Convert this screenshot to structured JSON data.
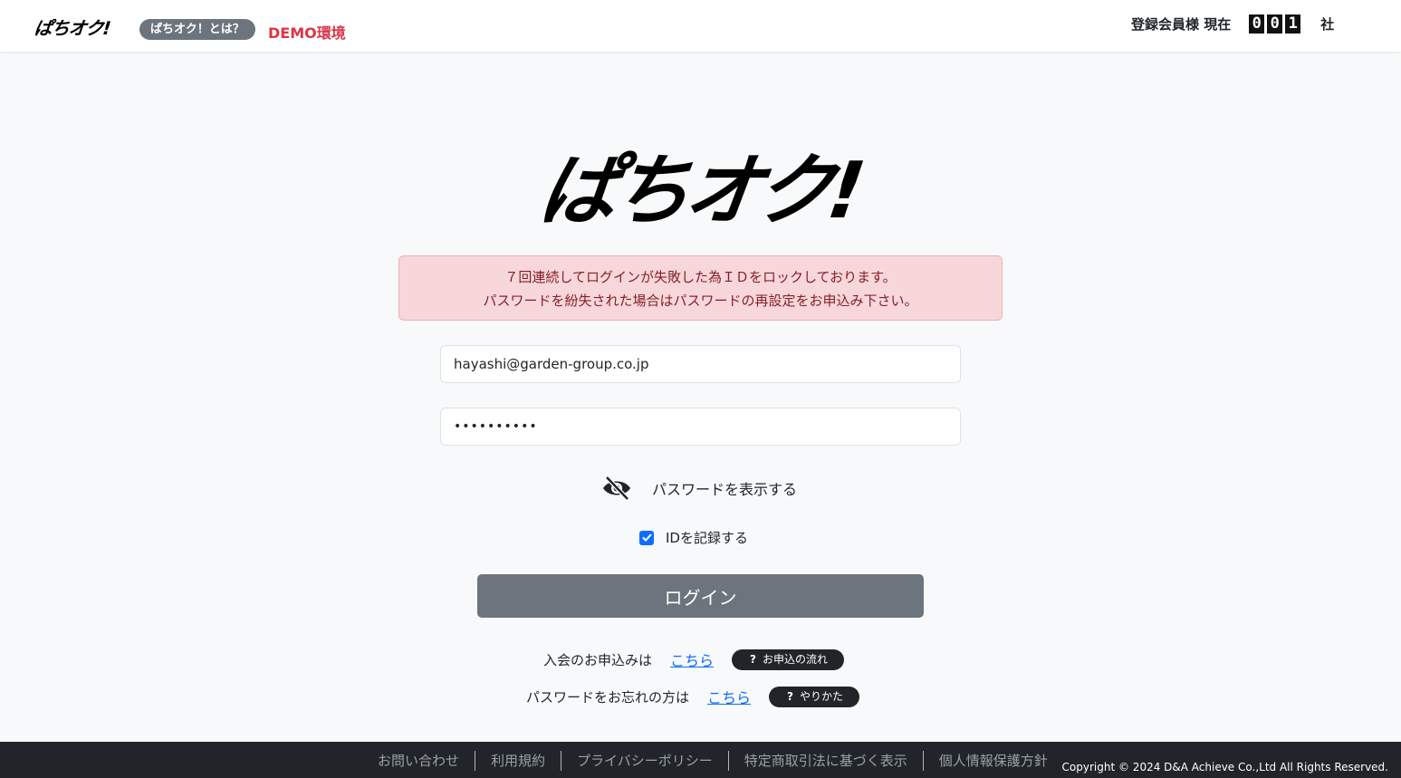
{
  "header": {
    "logo": "ぱちオク!",
    "about_badge": "ぱちオク！とは？",
    "demo_label": "DEMO環境",
    "members_label": "登録会員様 現在",
    "member_digits": [
      "0",
      "0",
      "1"
    ],
    "members_unit": "社"
  },
  "main": {
    "logo": "ぱちオク!",
    "alert_line1": "７回連続してログインが失敗した為ＩＤをロックしております。",
    "alert_line2": "パスワードを紛失された場合はパスワードの再設定をお申込み下さい。",
    "email_value": "hayashi@garden-group.co.jp",
    "password_value": "••••••••••",
    "show_password_label": "パスワードを表示する",
    "remember_label": "IDを記録する",
    "login_label": "ログイン",
    "signup_text": "入会のお申込みは",
    "signup_link": "こちら",
    "signup_pill": "お申込の流れ",
    "forgot_text": "パスワードをお忘れの方は",
    "forgot_link": "こちら",
    "forgot_pill": "やりかた",
    "pill_icon": "?"
  },
  "footer": {
    "links": [
      "お問い合わせ",
      "利用規約",
      "プライバシーポリシー",
      "特定商取引法に基づく表示",
      "個人情報保護方針"
    ],
    "copyright": "Copyright © 2024 D&A Achieve Co.,Ltd All Rights Reserved."
  },
  "colors": {
    "accent": "#0d6efd",
    "danger": "#dc3545",
    "alert_bg": "#f8d7da",
    "button_gray": "#6c757d",
    "footer_bg": "#212529"
  },
  "icons": [
    "eye-slash-icon",
    "check-icon",
    "question-icon"
  ]
}
